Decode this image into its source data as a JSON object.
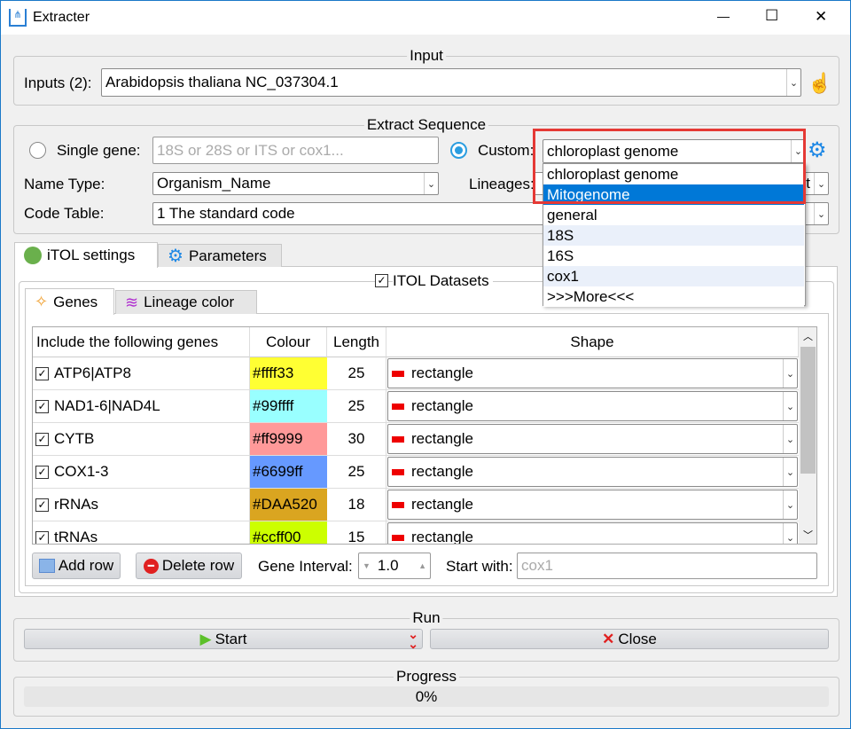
{
  "window": {
    "title": "Extracter",
    "minimize": "—",
    "maximize": "☐",
    "close": "✕"
  },
  "input": {
    "group_title": "Input",
    "label": "Inputs (2):",
    "value": "Arabidopsis thaliana NC_037304.1"
  },
  "extract": {
    "group_title": "Extract Sequence",
    "single_gene_label": "Single gene:",
    "single_gene_placeholder": "18S or 28S or ITS or cox1...",
    "custom_label": "Custom:",
    "custom_value": "chloroplast genome",
    "name_type_label": "Name Type:",
    "name_type_value": "Organism_Name",
    "lineages_label": "Lineages:",
    "lineages_value": "t",
    "code_table_label": "Code Table:",
    "code_table_value": "1 The standard code"
  },
  "dropdown": {
    "options": [
      "chloroplast genome",
      "Mitogenome",
      "general",
      "18S",
      "16S",
      "cox1",
      ">>>More<<<"
    ],
    "highlighted": "Mitogenome"
  },
  "tabs": [
    {
      "label": "iTOL settings"
    },
    {
      "label": "Parameters"
    }
  ],
  "itol": {
    "datasets_label": "ITOL Datasets",
    "checked": true
  },
  "subtabs": [
    {
      "label": "Genes"
    },
    {
      "label": "Lineage color"
    }
  ],
  "table": {
    "headers": [
      "Include the following genes",
      "Colour",
      "Length",
      "Shape"
    ],
    "rows": [
      {
        "gene": "ATP6|ATP8",
        "colour": "#ffff33",
        "length": "25",
        "shape": "rectangle",
        "checked": true
      },
      {
        "gene": "NAD1-6|NAD4L",
        "colour": "#99ffff",
        "length": "25",
        "shape": "rectangle",
        "checked": true
      },
      {
        "gene": "CYTB",
        "colour": "#ff9999",
        "length": "30",
        "shape": "rectangle",
        "checked": true
      },
      {
        "gene": "COX1-3",
        "colour": "#6699ff",
        "length": "25",
        "shape": "rectangle",
        "checked": true
      },
      {
        "gene": "rRNAs",
        "colour": "#DAA520",
        "length": "18",
        "shape": "rectangle",
        "checked": true
      },
      {
        "gene": "tRNAs",
        "colour": "#ccff00",
        "length": "15",
        "shape": "rectangle",
        "checked": true
      }
    ]
  },
  "genes_toolbar": {
    "add_row": "Add row",
    "delete_row": "Delete row",
    "gene_interval_label": "Gene Interval:",
    "gene_interval_value": "1.0",
    "start_with_label": "Start with:",
    "start_with_placeholder": "cox1"
  },
  "run": {
    "group_title": "Run",
    "start": "Start",
    "close": "Close"
  },
  "progress": {
    "group_title": "Progress",
    "value": "0%",
    "percent": 0
  },
  "colors": {
    "accent": "#2a9de0",
    "selection": "#0078d7",
    "highlight_box": "#e53935"
  }
}
